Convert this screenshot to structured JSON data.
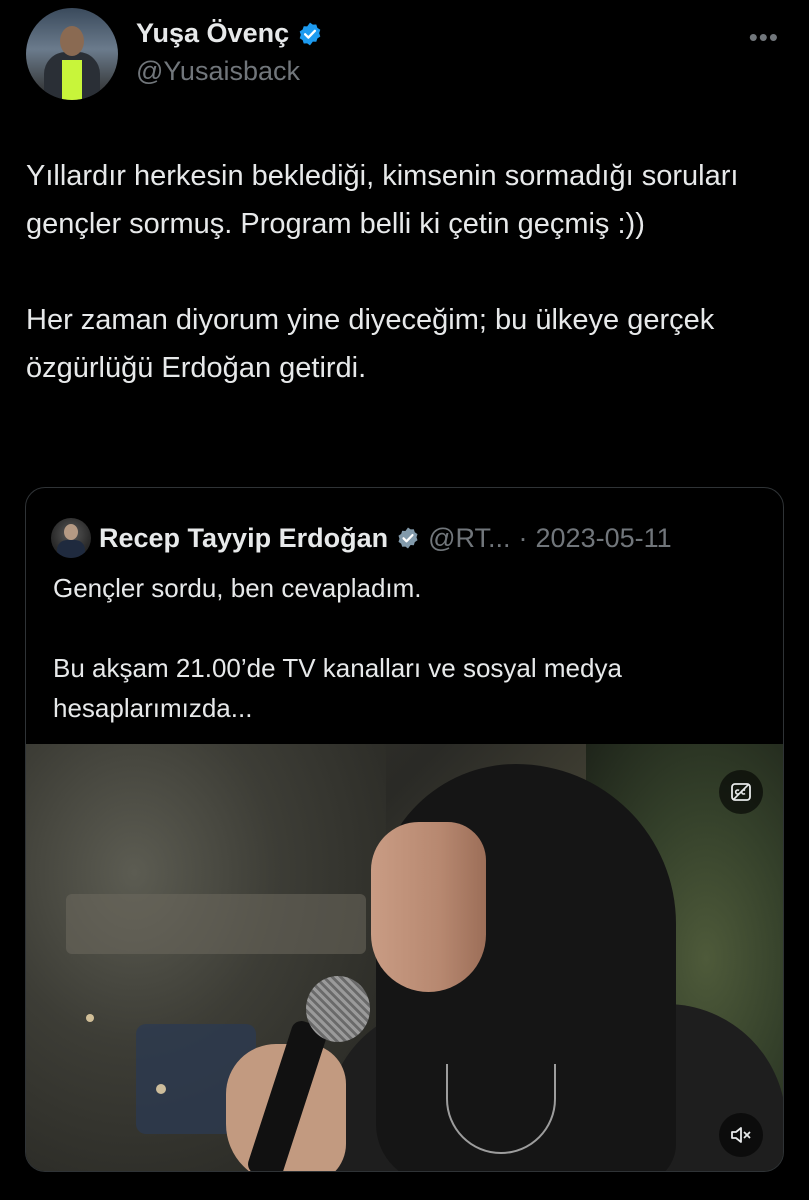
{
  "author": {
    "display_name": "Yuşa Övenç",
    "handle": "@Yusaisback",
    "avatar_icon": "profile-photo",
    "verified_icon": "verified-badge-icon",
    "verified_color": "#1d9bf0"
  },
  "more_icon": "more-options-icon",
  "more_label": "•••",
  "tweet": {
    "paragraphs": [
      "Yıllardır herkesin beklediği, kimsenin sormadığı soruları gençler sormuş. Program belli ki çetin geçmiş :))",
      "Her zaman diyorum yine diyeceğim; bu ülkeye gerçek özgürlüğü Erdoğan getirdi."
    ]
  },
  "quote": {
    "display_name": "Recep Tayyip Erdoğan",
    "handle": "@RT...",
    "separator": "·",
    "date": "2023-05-11",
    "verified_color": "#829aab",
    "paragraphs": [
      "Gençler sordu, ben cevapladım.",
      "Bu akşam 21.00’de TV kanalları ve sosyal medya hesaplarımızda..."
    ],
    "video": {
      "captions_icon": "captions-icon",
      "mute_icon": "muted-speaker-icon"
    }
  },
  "colors": {
    "background": "#000000",
    "text_primary": "#e7e9ea",
    "text_secondary": "#71767b",
    "border": "#2f3336"
  }
}
